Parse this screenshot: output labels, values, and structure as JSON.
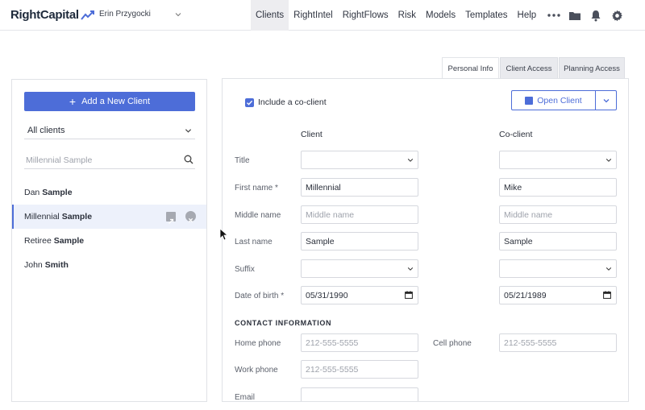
{
  "brand": {
    "name": "RightCapital"
  },
  "user": {
    "name": "Erin Przygocki"
  },
  "nav": {
    "items": [
      "Clients",
      "RightIntel",
      "RightFlows",
      "Risk",
      "Models",
      "Templates",
      "Help"
    ],
    "active": "Clients"
  },
  "tabs": [
    "Personal Info",
    "Client Access",
    "Planning Access"
  ],
  "left": {
    "add_button": "Add a New Client",
    "filter": "All clients",
    "search_placeholder": "Millennial Sample",
    "clients": [
      {
        "first": "Dan",
        "last": "Sample"
      },
      {
        "first": "Millennial",
        "last": "Sample"
      },
      {
        "first": "Retiree",
        "last": "Sample"
      },
      {
        "first": "John",
        "last": "Smith"
      }
    ]
  },
  "form": {
    "include_coclient": "Include a co-client",
    "open_client": "Open Client",
    "client_col": "Client",
    "coclient_col": "Co-client",
    "labels": {
      "title": "Title",
      "first_name": "First name *",
      "middle_name": "Middle name",
      "last_name": "Last name",
      "suffix": "Suffix",
      "dob": "Date of birth *",
      "contact_section": "CONTACT INFORMATION",
      "home_phone": "Home phone",
      "cell_phone": "Cell phone",
      "work_phone": "Work phone",
      "email": "Email"
    },
    "client": {
      "first_name": "Millennial",
      "middle_placeholder": "Middle name",
      "last_name": "Sample",
      "dob": "05/31/1990"
    },
    "coclient": {
      "first_name": "Mike",
      "middle_placeholder": "Middle name",
      "last_name": "Sample",
      "dob": "05/21/1989"
    },
    "phone_placeholder": "212-555-5555"
  },
  "colors": {
    "accent": "#4d6dd8",
    "nav_active_bg": "#ededf0"
  }
}
